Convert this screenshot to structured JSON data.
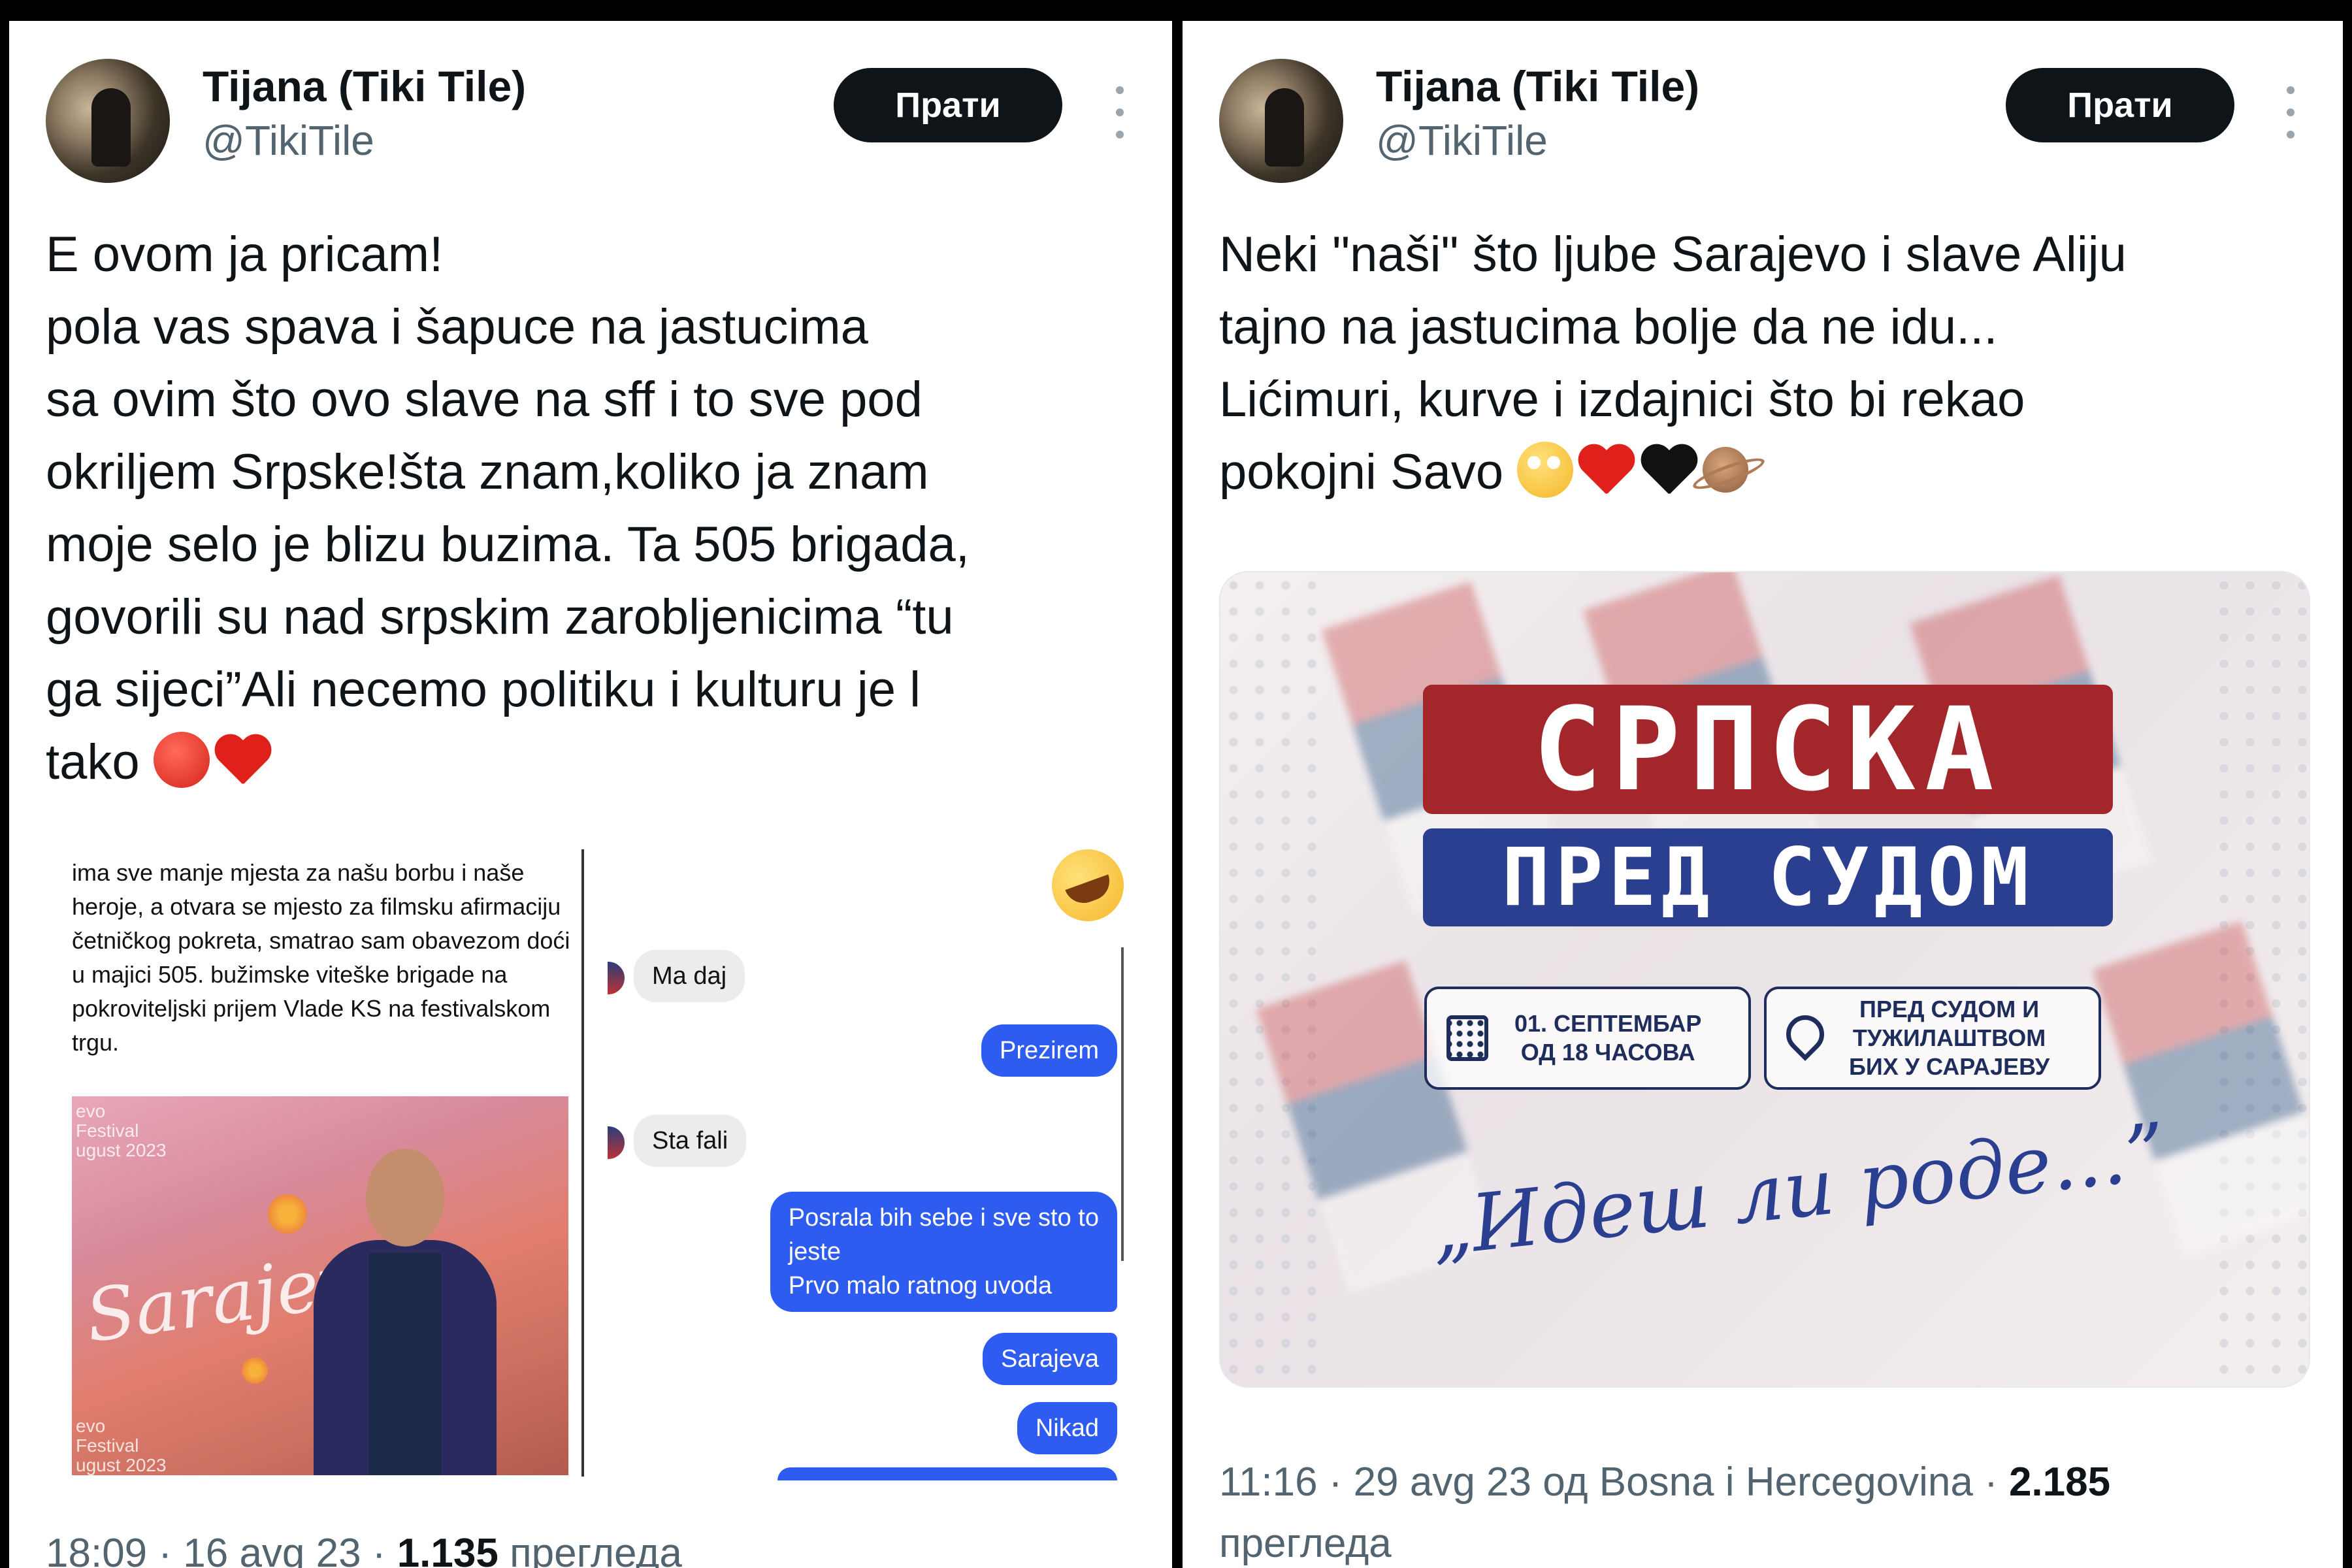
{
  "left_tweet": {
    "author_name": "Tijana (Tiki Tile)",
    "handle": "@TikiTile",
    "follow_label": "Прати",
    "text_lines": [
      "E ovom ja pricam!",
      "pola vas spava i šapuce na jastucima",
      "sa ovim što ovo slave na sff i to sve pod",
      "okriljem Srpske!šta znam,koliko ja znam",
      "moje selo je blizu buzima. Ta 505 brigada,",
      "govorili su nad srpskim zarobljenicima “tu",
      "ga sijeci”Ali necemo politiku i kulturu je l",
      "tako"
    ],
    "text_emojis": [
      "angry-face-emoji",
      "red-heart-emoji"
    ],
    "media": {
      "story_text": "ima sve manje mjesta za našu borbu i naše heroje, a otvara se mjesto za filmsku afirmaciju četničkog pokreta, smatrao sam obavezom doći u majici 505. bužimske viteške brigade na pokroviteljski prijem Vlade KS na festivalskom trgu.",
      "photo_script": "Sarajevo",
      "photo_caption_top": "evo\nFestival\nugust 2023",
      "photo_caption_bottom": "evo\nFestival\nugust 2023",
      "chat_messages": [
        {
          "direction": "in",
          "text": "Ma daj"
        },
        {
          "direction": "out",
          "text": "Prezirem"
        },
        {
          "direction": "in",
          "text": "Sta fali"
        },
        {
          "direction": "out",
          "text": "Posrala bih sebe i sve sto to\njeste\nPrvo malo ratnog uvoda"
        },
        {
          "direction": "out",
          "text": "Sarajeva"
        },
        {
          "direction": "out",
          "text": "Nikad"
        }
      ]
    },
    "meta": {
      "time": "18:09 · 16 avg 23 · ",
      "views": "1.135",
      "views_label": " прегледа"
    }
  },
  "right_tweet": {
    "author_name": "Tijana (Tiki Tile)",
    "handle": "@TikiTile",
    "follow_label": "Прати",
    "text_lines": [
      "Neki \"naši\" što ljube Sarajevo i slave Aliju",
      "tajno na jastucima bolje da ne idu...",
      "Lićimuri, kurve i izdajnici što bi rekao",
      "pokojni Savo"
    ],
    "text_emojis": [
      "face-with-rolling-eyes-emoji",
      "red-heart-emoji",
      "black-heart-emoji",
      "ringed-planet-emoji"
    ],
    "poster": {
      "title_top": "СРПСКА",
      "title_bottom": "ПРЕД СУДОМ",
      "date_text": "01. СЕПТЕМБАР\nОД 18 ЧАСОВА",
      "place_text": "ПРЕД СУДОМ И\nТУЖИЛАШТВОМ\nБИХ У САРАЈЕВУ",
      "slogan": "„Идеш ли роде...”",
      "colors": {
        "red": "#a3262a",
        "blue": "#2a3f8f",
        "navy": "#1f2d5c"
      }
    },
    "meta": {
      "time": "11:16 · 29 avg 23 од Bosna i Hercegovina · ",
      "views": "2.185",
      "views_label": "прегледа"
    }
  },
  "colors": {
    "text": "#0f1419",
    "secondary": "#536471",
    "button": "#0f1419",
    "chat_out": "#2e5cf0"
  }
}
